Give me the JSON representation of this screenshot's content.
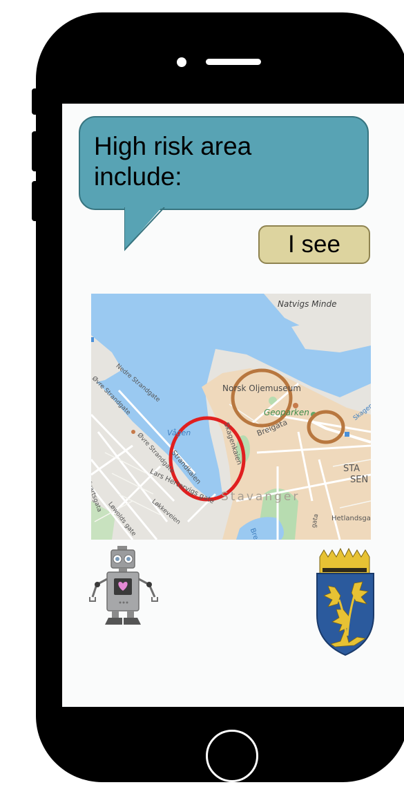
{
  "chat": {
    "bot_message": "High risk area include:",
    "user_reply": "I see"
  },
  "map": {
    "labels": {
      "natvigs_minde": "Natvigs Minde",
      "norsk_oljemuseum": "Norsk Oljemuseum",
      "geoparken": "Geoparken",
      "breigata": "Breigata",
      "vagen": "Vågen",
      "skagenkaien": "Skagenkaien",
      "strandkaien": "Strandkaien",
      "lars_hertervigs_gate": "Lars Hertervigs gate",
      "stavanger": "Stavanger",
      "nedre_strandgate": "Nedre Strandgate",
      "ovre_strandgate_1": "Øvre Strandgate",
      "ovre_strandgate_2": "Øvre Strandgate",
      "lowolds_gate": "Løwolds gate",
      "lokkeveien": "Løkkeveien",
      "hetlandsgata": "Hetlandsgata",
      "sta": "STA",
      "sen": "SEN",
      "kvartsgata": "Kvartsgata",
      "skagen": "Skagen",
      "gata": "gata",
      "breiavatnet": "Bre"
    },
    "risk_circle_colors": {
      "high": "#e01f1f",
      "medium": "#b8773f"
    }
  },
  "colors": {
    "bot_bubble": "#58a3b4",
    "user_bubble": "#ddd49f",
    "water": "#9ac9f1",
    "land_center": "#efd9bc"
  }
}
